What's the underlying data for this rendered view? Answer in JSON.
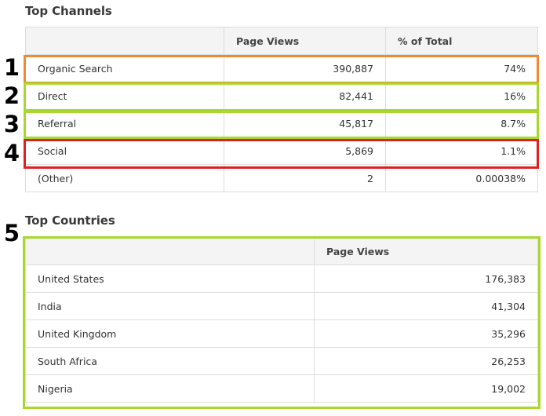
{
  "top_channels": {
    "title": "Top Channels",
    "columns": [
      "",
      "Page Views",
      "% of Total"
    ],
    "rows": [
      {
        "channel": "Organic Search",
        "page_views": "390,887",
        "pct": "74%"
      },
      {
        "channel": "Direct",
        "page_views": "82,441",
        "pct": "16%"
      },
      {
        "channel": "Referral",
        "page_views": "45,817",
        "pct": "8.7%"
      },
      {
        "channel": "Social",
        "page_views": "5,869",
        "pct": "1.1%"
      },
      {
        "channel": "(Other)",
        "page_views": "2",
        "pct": "0.00038%"
      }
    ]
  },
  "top_countries": {
    "title": "Top Countries",
    "columns": [
      "",
      "Page Views"
    ],
    "rows": [
      {
        "country": "United States",
        "page_views": "176,383"
      },
      {
        "country": "India",
        "page_views": "41,304"
      },
      {
        "country": "United Kingdom",
        "page_views": "35,296"
      },
      {
        "country": "South Africa",
        "page_views": "26,253"
      },
      {
        "country": "Nigeria",
        "page_views": "19,002"
      }
    ]
  },
  "annotations": {
    "markers": [
      "1",
      "2",
      "3",
      "4",
      "5"
    ],
    "colors": {
      "orange": "#ef8b2d",
      "green": "#a8d82c",
      "red": "#e02020"
    }
  }
}
